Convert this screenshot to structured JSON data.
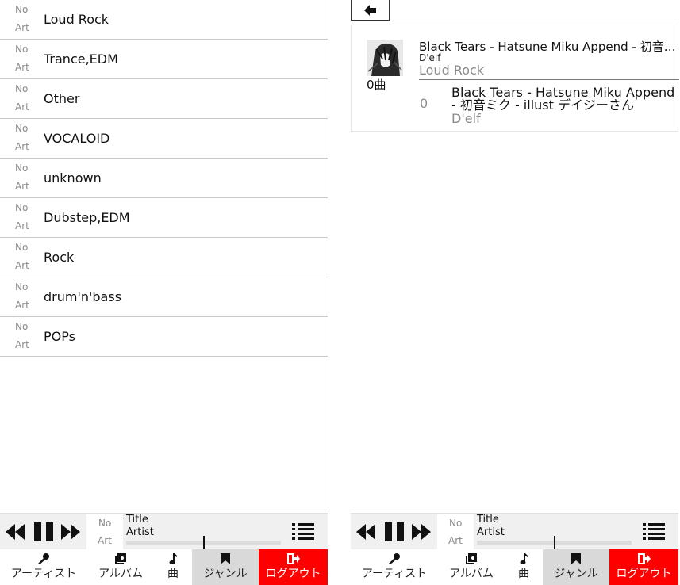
{
  "left": {
    "no_art": {
      "no": "No",
      "art": "Art"
    },
    "genres": [
      "Loud Rock",
      "Trance,EDM",
      "Other",
      "VOCALOID",
      "unknown",
      "Dubstep,EDM",
      "Rock",
      "drum'n'bass",
      "POPs"
    ]
  },
  "right": {
    "album": {
      "title": "Black Tears - Hatsune Miku Append - 初音ミク - illust デイジーさん",
      "artist": "D'elf",
      "genre": "Loud Rock",
      "count": "0曲"
    },
    "tracks": [
      {
        "number": "0",
        "title": "Black Tears - Hatsune Miku Append - 初音ミク - illust デイジーさん",
        "artist": "D'elf"
      }
    ]
  },
  "player": {
    "title": "Title",
    "artist": "Artist",
    "no_art": {
      "no": "No",
      "art": "Art"
    },
    "progress": 0.5
  },
  "nav": {
    "artist": "アーティスト",
    "album": "アルバム",
    "song": "曲",
    "genre": "ジャンル",
    "logout": "ログアウト"
  },
  "icons": {
    "rewind": "rewind-icon",
    "pause": "pause-icon",
    "forward": "fast-forward-icon",
    "playlist": "playlist-icon",
    "back": "arrow-left-icon",
    "artist": "microphone-icon",
    "album": "album-icon",
    "song": "music-note-icon",
    "genre": "bookmark-icon",
    "logout": "logout-icon"
  },
  "colors": {
    "logout_bg": "#ff0000",
    "active_tab_bg": "#d9d9d9",
    "player_bg": "#f0f0f0"
  }
}
